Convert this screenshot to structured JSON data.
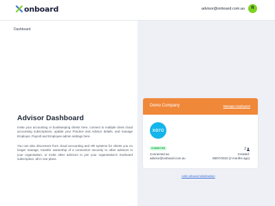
{
  "header": {
    "logo_text": "onboard",
    "user_email": "advisor@onboard.com.au",
    "avatar_initial": "R"
  },
  "breadcrumb": "Dashboard",
  "main": {
    "title": "Advisor Dashboard",
    "paragraph_1": "Invite your accounting or bookkeeping clients here, connect to multiple client cloud accounting subscriptions, update your Practice and Advisor details, and manage Employer, Payroll and Employee admin settings here.",
    "paragraph_2": "You can also disconnect from cloud accounting and HR systems for clients you no longer manage, transfer ownership of a connection securely to other advisors in your organisation, or invite other advisors to join your organisation's Xonboard subscription, all in one place."
  },
  "card": {
    "company_name": "Demo Company",
    "manage_label": "Manage employees",
    "provider_logo_text": "xero",
    "status": "CONNECTED",
    "user_count": "2",
    "connected_as_label": "Connected as:",
    "connected_as_value": "advisor@onboard.com.au",
    "created_label": "Created:",
    "created_value": "08/07/2023 (2 months ago)"
  },
  "add_destination_label": "Add onboard destination",
  "colors": {
    "card_header": "#f0883a",
    "avatar": "#7ed321",
    "link": "#3b6fd8",
    "status_green": "#16a34a",
    "xero_blue": "#13b5ea",
    "panel_bg": "#eef0f6"
  }
}
